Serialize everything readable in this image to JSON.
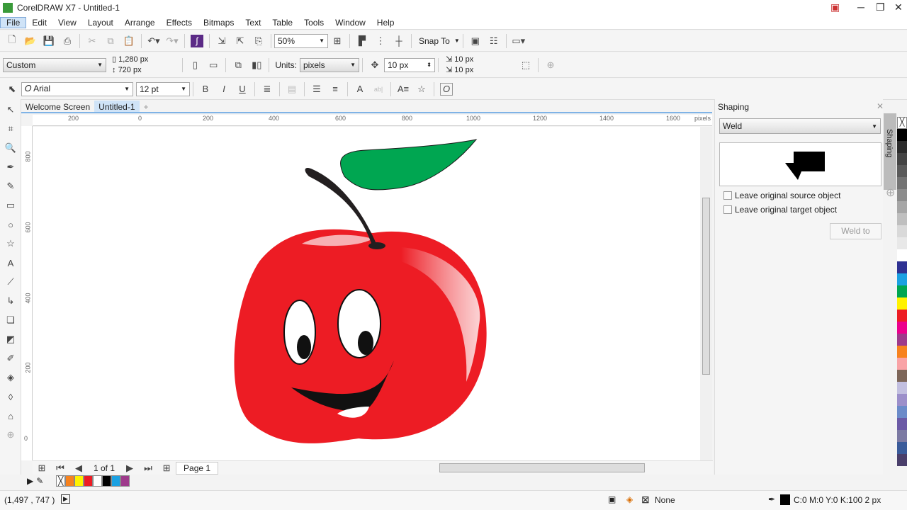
{
  "window": {
    "title": "CorelDRAW X7 - Untitled-1"
  },
  "menu": [
    "File",
    "Edit",
    "View",
    "Layout",
    "Arrange",
    "Effects",
    "Bitmaps",
    "Text",
    "Table",
    "Tools",
    "Window",
    "Help"
  ],
  "standard_toolbar": {
    "zoom": "50%",
    "snap_to": "Snap To"
  },
  "property_bar": {
    "page_preset": "Custom",
    "width": "1,280 px",
    "height": "720 px",
    "units_label": "Units:",
    "units": "pixels",
    "nudge": "10 px",
    "dup_x": "10 px",
    "dup_y": "10 px"
  },
  "text_bar": {
    "font": "Arial",
    "size": "12 pt"
  },
  "doc_tabs": [
    "Welcome Screen",
    "Untitled-1"
  ],
  "ruler": {
    "h_ticks": [
      "200",
      "0",
      "200",
      "400",
      "600",
      "800",
      "1000",
      "1200",
      "1400",
      "1600"
    ],
    "unit": "pixels",
    "v_ticks": [
      "800",
      "600",
      "400",
      "200",
      "0"
    ]
  },
  "page_nav": {
    "count": "1 of 1",
    "page_tab": "Page 1"
  },
  "doc_palette": [
    "#f7821e",
    "#fff200",
    "#ed1c24",
    "#ffffff",
    "#000000",
    "#1ba1e2",
    "#9e3a8b"
  ],
  "docker": {
    "title": "Shaping",
    "mode": "Weld",
    "opt1": "Leave original source object",
    "opt2": "Leave original target object",
    "apply": "Weld to",
    "tab": "Shaping"
  },
  "palette": [
    "#000000",
    "#2b2b2b",
    "#444444",
    "#5a5a5a",
    "#737373",
    "#8c8c8c",
    "#a6a6a6",
    "#bfbfbf",
    "#d9d9d9",
    "#e8e8e8",
    "#ffffff",
    "#2e3192",
    "#1ba1e2",
    "#00a651",
    "#fff200",
    "#ed1c24",
    "#ec008c",
    "#9e3a8b",
    "#f7821e",
    "#f9a3a6",
    "#7d6659",
    "#c2bfe0",
    "#9c8fca",
    "#6b8bc9",
    "#6b5aa6",
    "#7c7aa3",
    "#3a5b9a",
    "#4a3f6b"
  ],
  "status": {
    "coords": "(1,497 , 747   )",
    "fill": "None",
    "outline": "C:0 M:0 Y:0 K:100  2 px"
  }
}
